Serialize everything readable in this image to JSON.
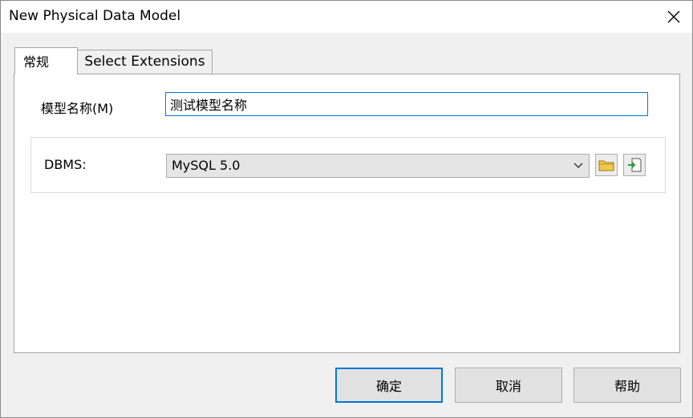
{
  "window": {
    "title": "New Physical Data Model"
  },
  "tabs": [
    {
      "label": "常规",
      "selected": true
    },
    {
      "label": "Select Extensions",
      "selected": false
    }
  ],
  "general": {
    "name_label": "模型名称(M)",
    "name_value": "测试模型名称",
    "dbms_label": "DBMS:",
    "dbms_value": "MySQL 5.0"
  },
  "buttons": {
    "ok": "确定",
    "cancel": "取消",
    "help": "帮助"
  },
  "colors": {
    "accent": "#0078d7",
    "folder": "#f2c94c",
    "import_arrow": "#2e9d3a"
  }
}
